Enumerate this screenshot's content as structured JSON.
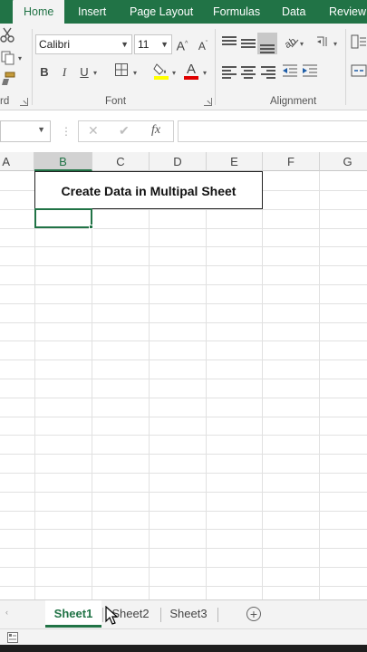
{
  "ribbon": {
    "tabs": [
      "Home",
      "Insert",
      "Page Layout",
      "Formulas",
      "Data",
      "Review"
    ],
    "active_tab": "Home",
    "font": {
      "name": "Calibri",
      "size": "11",
      "group_label": "Font"
    },
    "clipboard": {
      "group_label_partial": "rd"
    },
    "alignment": {
      "group_label": "Alignment"
    },
    "accent_color": "#217346",
    "fill_color": "#ffff00",
    "font_color": "#e00000"
  },
  "formula_bar": {
    "fx_label": "fx",
    "cancel_label": "✕",
    "enter_label": "✔"
  },
  "grid": {
    "columns": [
      "A",
      "B",
      "C",
      "D",
      "E",
      "F",
      "G"
    ],
    "selected_column": "B",
    "merged_cell_text": "Create Data in Multipal Sheet"
  },
  "sheets": {
    "tabs": [
      "Sheet1",
      "Sheet2",
      "Sheet3"
    ],
    "active": "Sheet1",
    "add_label": "+"
  }
}
